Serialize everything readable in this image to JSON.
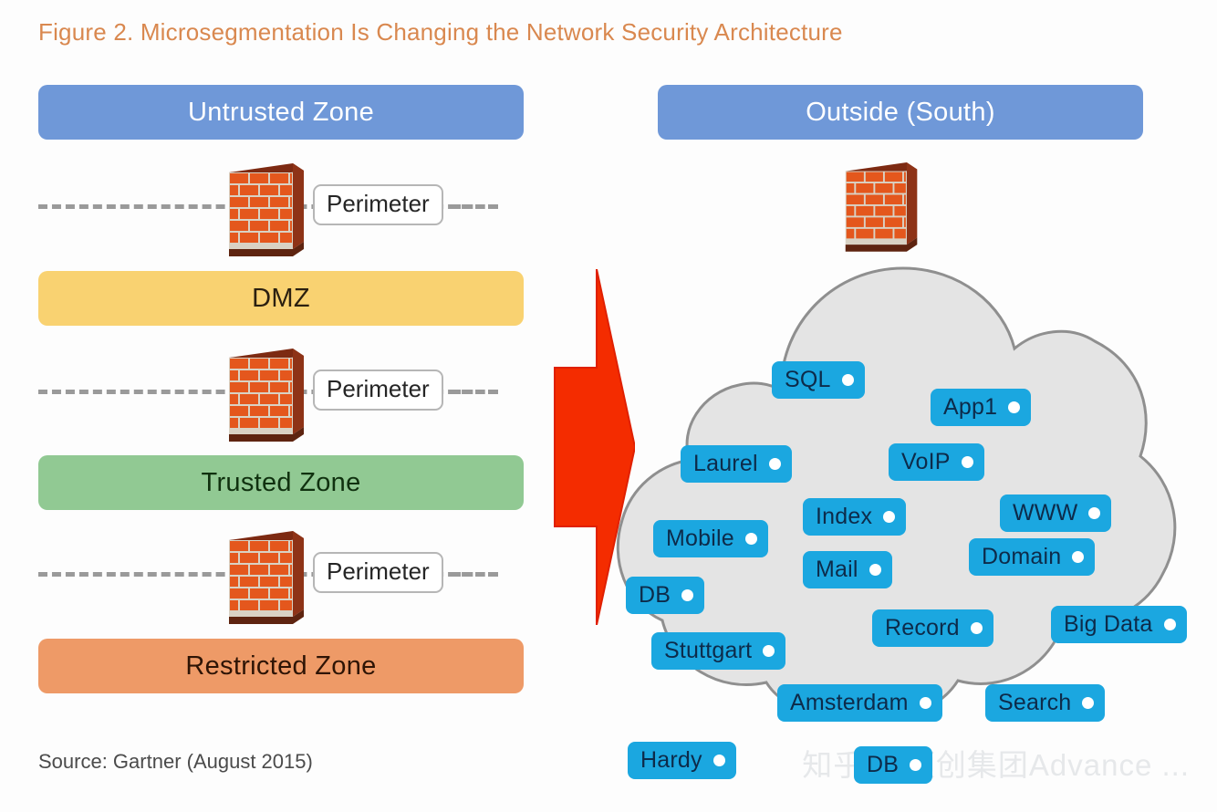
{
  "figure": {
    "title": "Figure 2. Microsegmentation Is Changing the Network Security Architecture",
    "source": "Source: Gartner (August 2015)",
    "watermark": "知乎 @领创集团Advance ...",
    "title_color": "#d9884f"
  },
  "left_panel": {
    "zones": [
      {
        "label": "Untrusted Zone",
        "color": "#6f98d8",
        "text_color": "#ffffff"
      },
      {
        "label": "DMZ",
        "color": "#f9d271",
        "text_color": "#2b2010"
      },
      {
        "label": "Trusted Zone",
        "color": "#91c993",
        "text_color": "#10310f"
      },
      {
        "label": "Restricted Zone",
        "color": "#ee9a67",
        "text_color": "#2e1405"
      }
    ],
    "perimeters": [
      {
        "label": "Perimeter",
        "icon": "brick-firewall-icon"
      },
      {
        "label": "Perimeter",
        "icon": "brick-firewall-icon"
      },
      {
        "label": "Perimeter",
        "icon": "brick-firewall-icon"
      }
    ]
  },
  "transition": {
    "icon": "right-arrow-icon",
    "color": "#f42c00"
  },
  "right_panel": {
    "header": {
      "label": "Outside (South)",
      "color": "#6f98d8",
      "text_color": "#ffffff"
    },
    "firewall_icon": "brick-firewall-icon",
    "cloud": {
      "fill": "#e4e4e4",
      "stroke": "#8f8f8f",
      "node_color": "#1ba7e0",
      "node_text_color": "#0d2b4a"
    },
    "nodes": [
      {
        "label": "SQL"
      },
      {
        "label": "App1"
      },
      {
        "label": "Laurel"
      },
      {
        "label": "VoIP"
      },
      {
        "label": "Index"
      },
      {
        "label": "WWW"
      },
      {
        "label": "Mobile"
      },
      {
        "label": "Mail"
      },
      {
        "label": "Domain"
      },
      {
        "label": "DB"
      },
      {
        "label": "Record"
      },
      {
        "label": "Big Data"
      },
      {
        "label": "Stuttgart"
      },
      {
        "label": "Amsterdam"
      },
      {
        "label": "Search"
      },
      {
        "label": "Hardy"
      },
      {
        "label": "DB"
      }
    ]
  }
}
